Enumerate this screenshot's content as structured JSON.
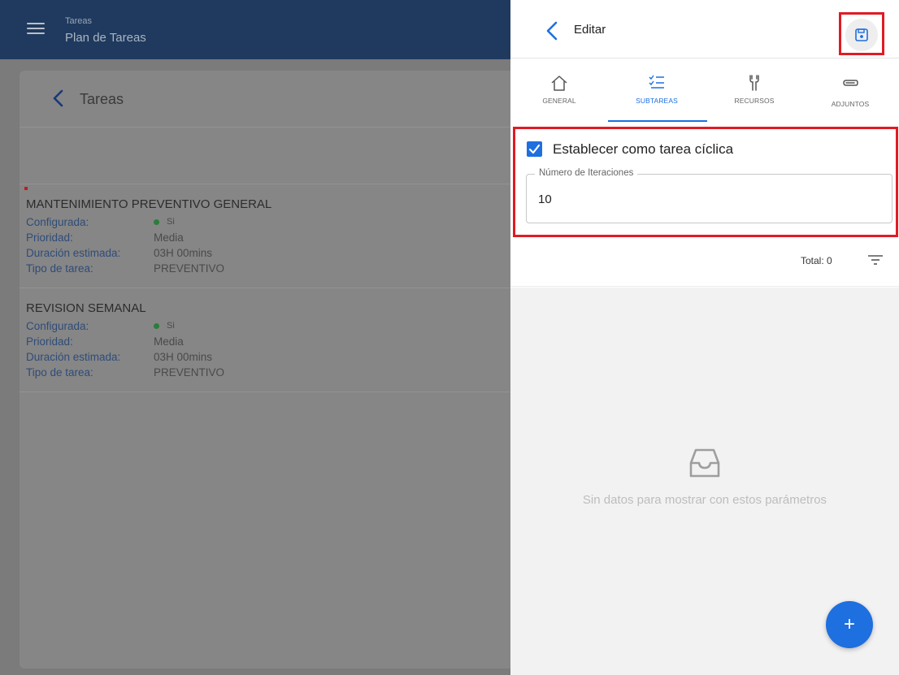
{
  "app": {
    "section": "Tareas",
    "title": "Plan de Tareas"
  },
  "list": {
    "title": "Tareas",
    "tasks": [
      {
        "name": "MANTENIMIENTO PREVENTIVO GENERAL",
        "configured_label": "Configurada:",
        "configured_value": "Si",
        "priority_label": "Prioridad:",
        "priority_value": "Media",
        "duration_label": "Duración estimada:",
        "duration_value": "03H 00mins",
        "type_label": "Tipo de tarea:",
        "type_value": "PREVENTIVO"
      },
      {
        "name": "REVISION SEMANAL",
        "configured_label": "Configurada:",
        "configured_value": "Si",
        "priority_label": "Prioridad:",
        "priority_value": "Media",
        "duration_label": "Duración estimada:",
        "duration_value": "03H 00mins",
        "type_label": "Tipo de tarea:",
        "type_value": "PREVENTIVO"
      }
    ]
  },
  "panel": {
    "title": "Editar",
    "tabs": [
      {
        "label": "GENERAL",
        "icon": "home-icon"
      },
      {
        "label": "SUBTAREAS",
        "icon": "checklist-icon",
        "active": true
      },
      {
        "label": "RECURSOS",
        "icon": "tools-icon"
      },
      {
        "label": "ADJUNTOS",
        "icon": "paperclip-icon"
      }
    ],
    "cyclic_label": "Establecer como tarea cíclica",
    "cyclic_checked": true,
    "iterations_label": "Número de Iteraciones",
    "iterations_value": "10",
    "total_label": "Total: 0",
    "empty_text": "Sin datos para mostrar con estos parámetros",
    "fab_label": "+"
  },
  "colors": {
    "accent": "#1e6fe0",
    "highlight": "#e01b24",
    "header": "#1f3a5e"
  }
}
